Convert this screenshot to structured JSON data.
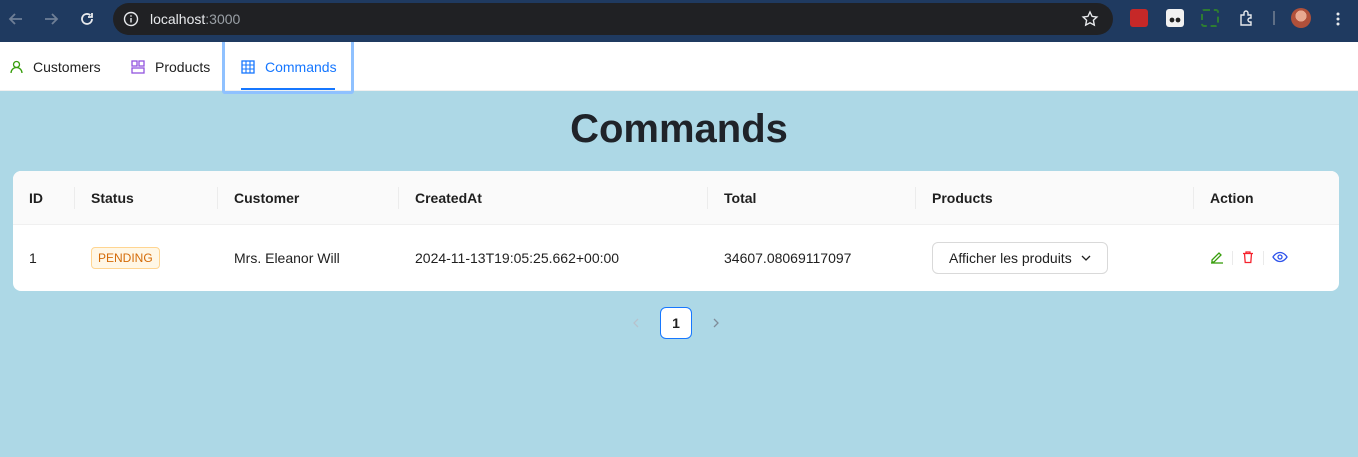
{
  "browser": {
    "url_host": "localhost",
    "url_port": ":3000"
  },
  "menu": {
    "items": [
      {
        "label": "Customers",
        "icon": "user-icon"
      },
      {
        "label": "Products",
        "icon": "grid-icon"
      },
      {
        "label": "Commands",
        "icon": "table-icon"
      }
    ],
    "active": "Commands"
  },
  "page": {
    "title": "Commands"
  },
  "table": {
    "columns": [
      "ID",
      "Status",
      "Customer",
      "CreatedAt",
      "Total",
      "Products",
      "Action"
    ],
    "rows": [
      {
        "id": "1",
        "status": "PENDING",
        "customer": "Mrs. Eleanor Will",
        "created_at": "2024-11-13T19:05:25.662+00:00",
        "total": "34607.08069117097",
        "products_button": "Afficher les produits"
      }
    ]
  },
  "pagination": {
    "current": "1"
  },
  "colors": {
    "accent": "#1677ff",
    "page_background": "#add8e6",
    "status_pending": "#d46b08",
    "edit": "#389e0d",
    "delete": "#f5222d",
    "view": "#2f54eb"
  }
}
